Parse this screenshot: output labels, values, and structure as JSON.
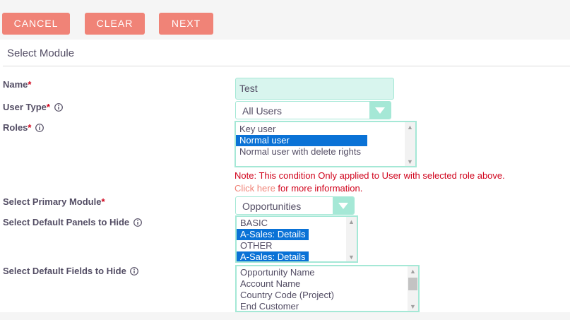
{
  "toolbar": {
    "cancel_label": "CANCEL",
    "clear_label": "CLEAR",
    "next_label": "NEXT"
  },
  "section": {
    "title": "Select Module"
  },
  "form": {
    "name": {
      "label": "Name",
      "required_mark": "*",
      "value": "Test"
    },
    "user_type": {
      "label": "User Type",
      "required_mark": "*",
      "selected": "All Users"
    },
    "roles": {
      "label": "Roles",
      "required_mark": "*",
      "options": [
        "Key user",
        "Normal user",
        "Normal user with delete rights"
      ],
      "selected": [
        "Normal user"
      ]
    },
    "note": {
      "line1": "Note: This condition Only applied to User with selected role above.",
      "link_text": "Click here",
      "line2_rest": " for more information."
    },
    "primary_module": {
      "label": "Select Primary Module",
      "required_mark": "*",
      "selected": "Opportunities"
    },
    "panels_to_hide": {
      "label": "Select Default Panels to Hide",
      "options": [
        "BASIC",
        "A-Sales: Details",
        "OTHER",
        "A-Sales: Details"
      ],
      "selected_indices": [
        1,
        3
      ]
    },
    "fields_to_hide": {
      "label": "Select Default Fields to Hide",
      "options": [
        "Opportunity Name",
        "Account Name",
        "Country Code (Project)",
        "End Customer"
      ]
    }
  },
  "colors": {
    "button": "#f08377",
    "accent": "#a5e8d6",
    "input_bg": "#d8f5ee",
    "selection": "#0a72d6",
    "required": "#d0021b"
  }
}
